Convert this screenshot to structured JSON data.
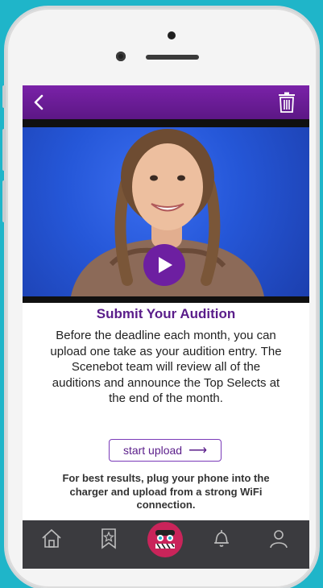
{
  "colors": {
    "background": "#1fb5c9",
    "header": "#6a1b9a",
    "accent": "#5a1d8a",
    "tabbar": "#3b3b3f",
    "brand_center": "#c9245a"
  },
  "header": {
    "back_icon": "chevron-left-icon",
    "delete_icon": "trash-icon"
  },
  "video": {
    "play_icon": "play-icon"
  },
  "content": {
    "title": "Submit Your Audition",
    "description": "Before the deadline each month, you can upload one take as your audition entry. The Scenebot team will review all of the auditions and announce the Top Selects at the end of the month.",
    "upload_label": "start upload",
    "upload_arrow": "⟶",
    "tip": "For best results, plug your phone into the charger and upload from a strong WiFi connection."
  },
  "tabbar": {
    "items": [
      "home-icon",
      "bookmark-star-icon",
      "scenebot-logo-icon",
      "bell-icon",
      "profile-icon"
    ]
  }
}
